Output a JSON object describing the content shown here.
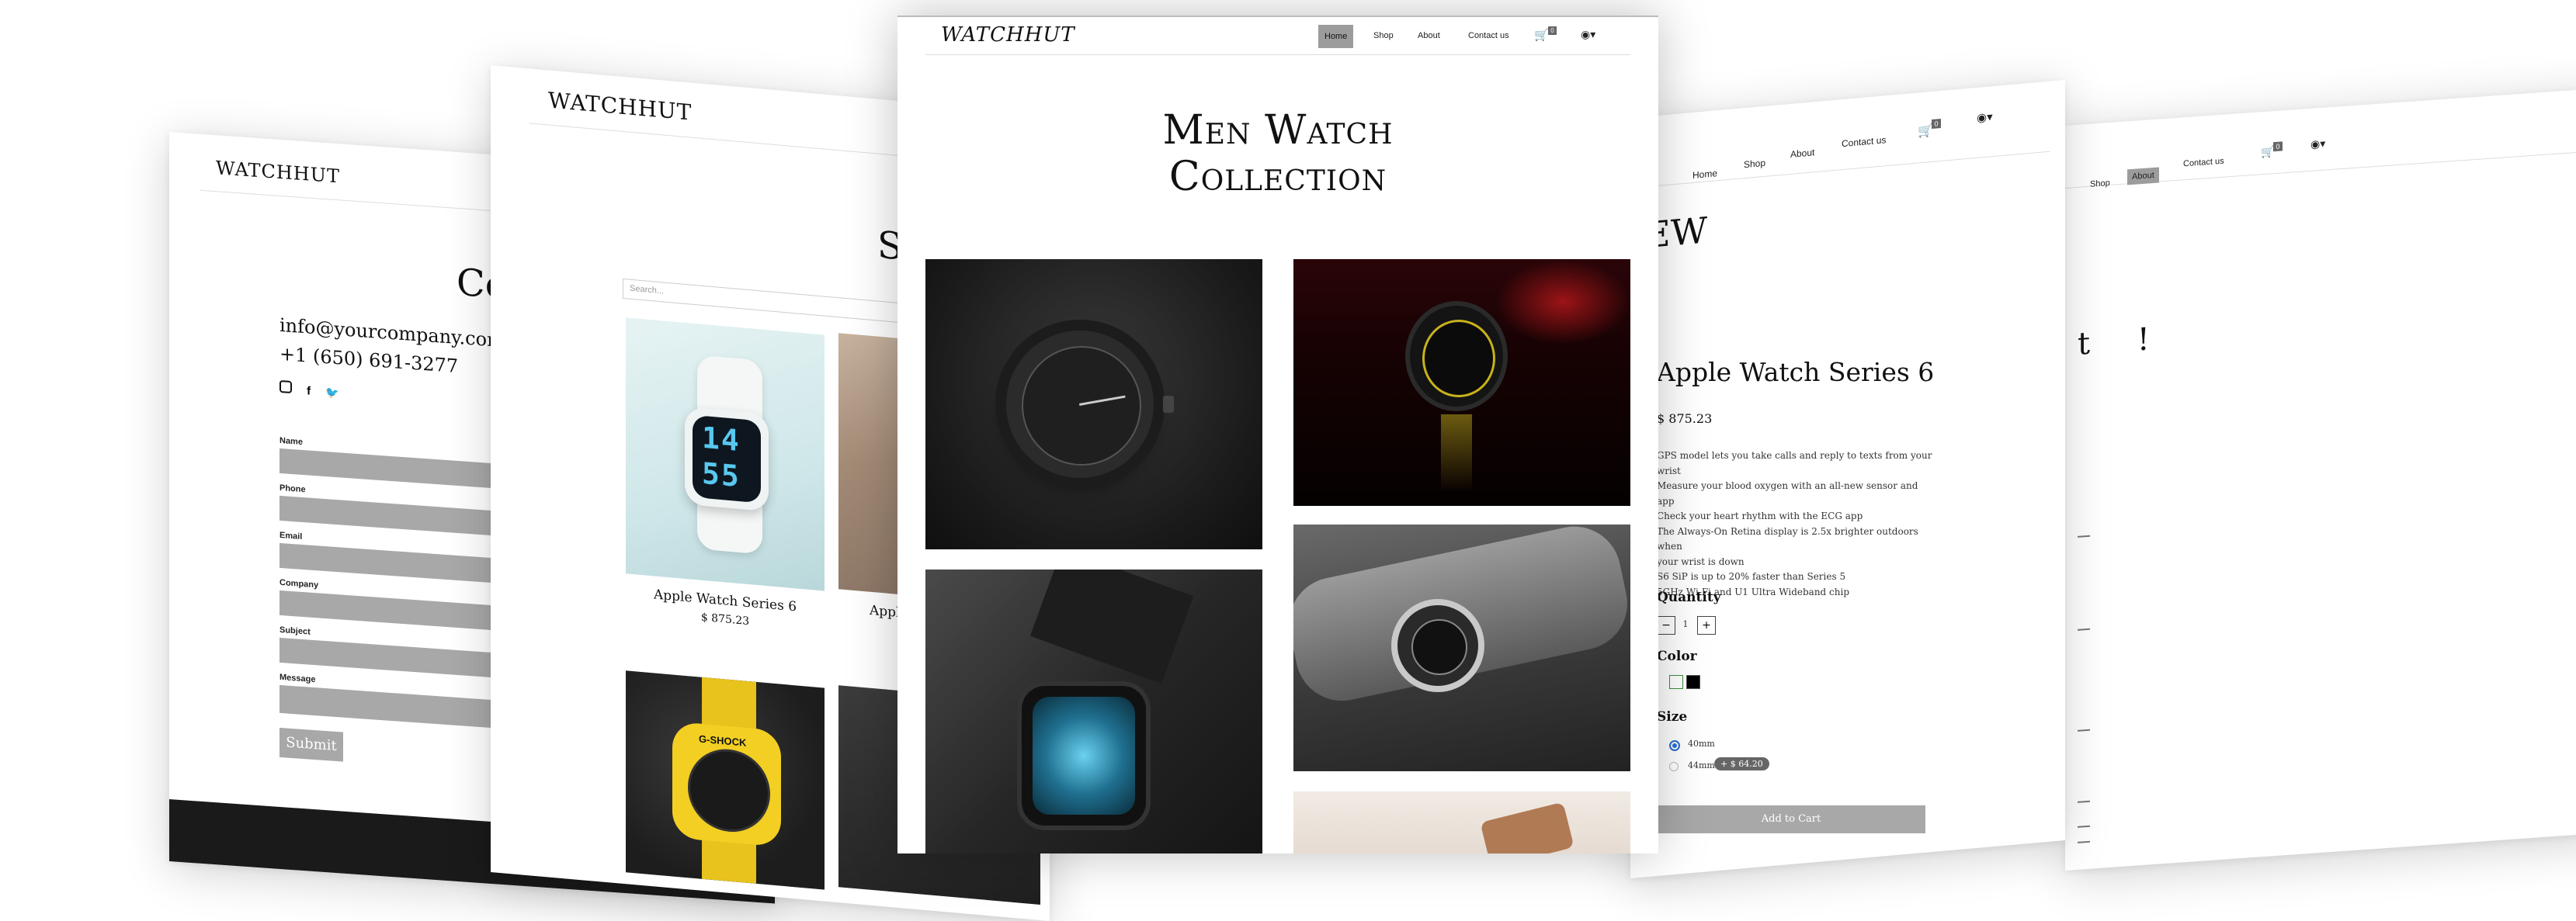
{
  "brand": "WATCHHUT",
  "nav": {
    "home": "Home",
    "shop": "Shop",
    "about": "About",
    "contact": "Contact us",
    "cart_count": "0"
  },
  "contact_page": {
    "heading": "Co",
    "email": "info@yourcompany.com",
    "phone": "+1 (650) 691-3277",
    "fields": [
      "Name",
      "Phone",
      "Email",
      "Company",
      "Subject",
      "Message"
    ],
    "submit": "Submit"
  },
  "shop_page": {
    "heading": "S",
    "search_placeholder": "Search...",
    "products": [
      {
        "name": "Apple Watch Series 6",
        "price": "$ 875.23"
      },
      {
        "name": "Apple",
        "price": ""
      }
    ],
    "watch_face": [
      "14",
      "55"
    ],
    "gshock_brand": "G-SHOCK"
  },
  "home_page": {
    "hero_line1": "Men Watch",
    "hero_line2": "Collection"
  },
  "product_page": {
    "heading_fragment": "IEW",
    "title": "Apple Watch Series 6",
    "price": "$ 875.23",
    "description": [
      "GPS model lets you take calls and reply to texts from your",
      "wrist",
      "Measure your blood oxygen with an all-new sensor and app",
      "Check your heart rhythm with the ECG app",
      "The Always-On Retina display is 2.5x brighter outdoors when",
      "your wrist is down",
      "S6 SiP is up to 20% faster than Series 5",
      "5GHz Wi-Fi and U1 Ultra Wideband chip"
    ],
    "quantity_label": "Quantity",
    "quantity_value": "1",
    "minus": "−",
    "plus": "+",
    "color_label": "Color",
    "colors": [
      "#ffffff",
      "#000000"
    ],
    "size_label": "Size",
    "sizes": [
      "40mm",
      "44mm"
    ],
    "size_extra": "+ $ 64.20",
    "add_to_cart": "Add to Cart"
  },
  "about_page": {
    "heading_fragment": "t !"
  },
  "colors": {
    "field_gray": "#a8a8a8",
    "active_nav": "#9c9c9c",
    "footer_dark": "#1a1a1a"
  }
}
